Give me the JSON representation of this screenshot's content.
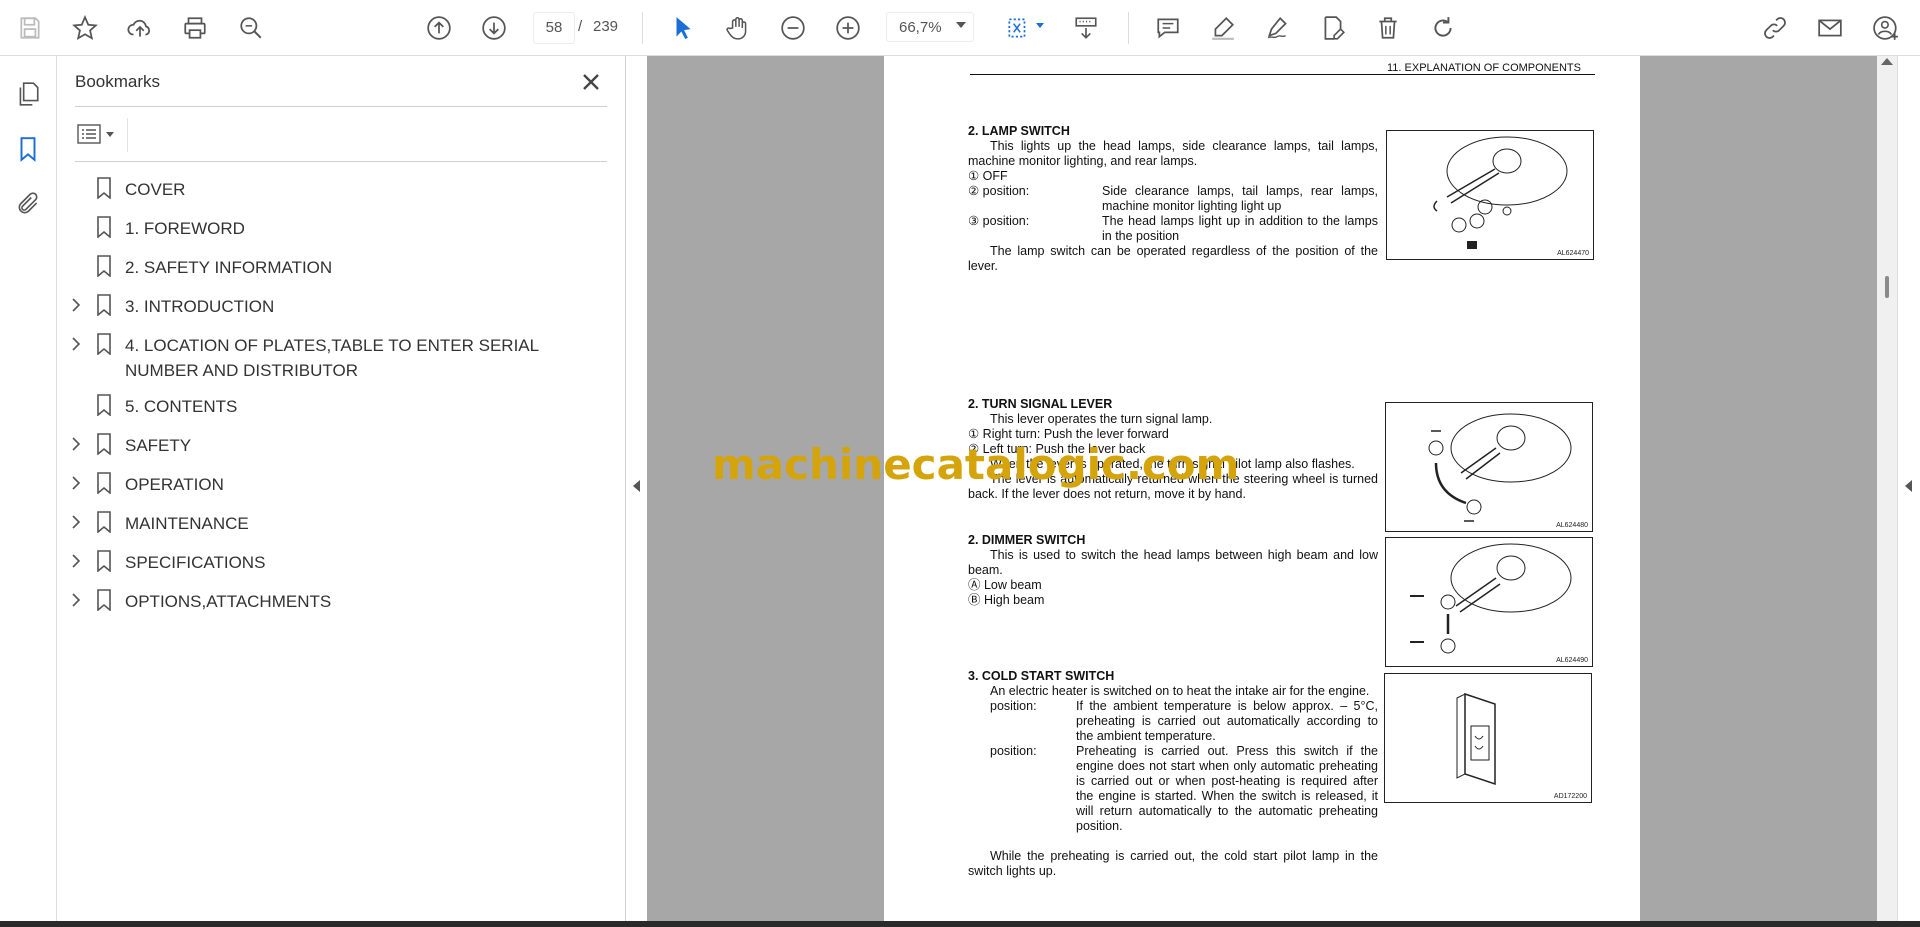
{
  "toolbar": {
    "page_current": "58",
    "page_separator": "/",
    "page_total": "239",
    "zoom": "66,7%"
  },
  "bookmarks": {
    "title": "Bookmarks",
    "items": [
      {
        "label": "COVER",
        "expandable": false
      },
      {
        "label": "1. FOREWORD",
        "expandable": false
      },
      {
        "label": "2. SAFETY INFORMATION",
        "expandable": false
      },
      {
        "label": "3. INTRODUCTION",
        "expandable": true
      },
      {
        "label": "4. LOCATION OF PLATES,TABLE TO ENTER SERIAL NUMBER AND DISTRIBUTOR",
        "expandable": true
      },
      {
        "label": "5. CONTENTS",
        "expandable": false
      },
      {
        "label": "SAFETY",
        "expandable": true
      },
      {
        "label": "OPERATION",
        "expandable": true
      },
      {
        "label": "MAINTENANCE",
        "expandable": true
      },
      {
        "label": "SPECIFICATIONS",
        "expandable": true
      },
      {
        "label": "OPTIONS,ATTACHMENTS",
        "expandable": true
      }
    ]
  },
  "document": {
    "header": "11. EXPLANATION OF COMPONENTS",
    "lamp": {
      "heading": "2.   LAMP SWITCH",
      "intro": "This lights up the head lamps, side clearance lamps, tail lamps, machine monitor lighting, and rear lamps.",
      "l1": "① OFF",
      "l2a": "②            position:",
      "l2b": "Side clearance lamps, tail lamps, rear lamps, machine monitor lighting light up",
      "l3a": "③         position:",
      "l3b": "The head lamps light up in addition to the lamps in the            position",
      "note": "The lamp switch can be operated regardless of the position of the lever.",
      "fig_code": "AL624470"
    },
    "turn": {
      "heading": "2.   TURN SIGNAL LEVER",
      "intro": "This lever operates the turn signal lamp.",
      "l1": "① Right turn:      Push the lever forward",
      "l2": "② Left turn:        Push the lever back",
      "l3": "When the lever is operated, the turn signal pilot lamp also flashes.",
      "note": "The lever is automatically returned when the steering wheel is turned back. If the lever does not return, move it by hand.",
      "fig_code": "AL624480"
    },
    "dimmer": {
      "heading": "2.   DIMMER SWITCH",
      "intro": "This is used to switch the head lamps between high beam and low beam.",
      "l1": "Ⓐ Low beam",
      "l2": "Ⓑ High beam",
      "fig_code": "AL624490"
    },
    "cold": {
      "heading": "3.   COLD START SWITCH",
      "intro": "An electric heater is switched on to heat the intake air for the engine.",
      "p1a": "position:",
      "p1b": "If the ambient temperature is below approx. – 5°C, preheating is carried out automatically according to the ambient temperature.",
      "p2a": "position:",
      "p2b": "Preheating is carried out. Press this switch if the engine does not start when only automatic preheating is carried out or when post-heating is required after the engine is started. When the switch is released, it will return automatically to the automatic preheating position.",
      "note": "While the preheating is carried out, the cold start pilot lamp in the switch lights up.",
      "fig_code": "AD172200"
    },
    "watermark": "machinecatalogic.com"
  }
}
